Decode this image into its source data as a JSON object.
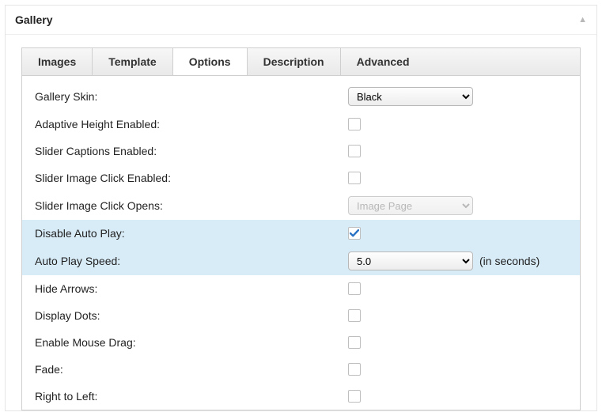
{
  "panel": {
    "title": "Gallery"
  },
  "tabs": [
    {
      "label": "Images",
      "active": false
    },
    {
      "label": "Template",
      "active": false
    },
    {
      "label": "Options",
      "active": true
    },
    {
      "label": "Description",
      "active": false
    },
    {
      "label": "Advanced",
      "active": false
    }
  ],
  "skin": {
    "label": "Gallery Skin:",
    "value": "Black",
    "options": [
      "Black"
    ]
  },
  "clickOpens": {
    "label": "Slider Image Click Opens:",
    "value": "Image Page",
    "disabled": true,
    "options": [
      "Image Page"
    ]
  },
  "autoplaySpeed": {
    "label": "Auto Play Speed:",
    "value": "5.0",
    "suffix": "(in seconds)",
    "options": [
      "5.0"
    ],
    "highlight": true
  },
  "checkRows": {
    "adaptiveHeight": {
      "label": "Adaptive Height Enabled:",
      "checked": false,
      "highlight": false
    },
    "sliderCaptions": {
      "label": "Slider Captions Enabled:",
      "checked": false,
      "highlight": false
    },
    "sliderImageClick": {
      "label": "Slider Image Click Enabled:",
      "checked": false,
      "highlight": false
    },
    "disableAutoplay": {
      "label": "Disable Auto Play:",
      "checked": true,
      "highlight": true
    },
    "hideArrows": {
      "label": "Hide Arrows:",
      "checked": false,
      "highlight": false
    },
    "displayDots": {
      "label": "Display Dots:",
      "checked": false,
      "highlight": false
    },
    "enableMouseDrag": {
      "label": "Enable Mouse Drag:",
      "checked": false,
      "highlight": false
    },
    "fade": {
      "label": "Fade:",
      "checked": false,
      "highlight": false
    },
    "rtl": {
      "label": "Right to Left:",
      "checked": false,
      "highlight": false
    }
  }
}
